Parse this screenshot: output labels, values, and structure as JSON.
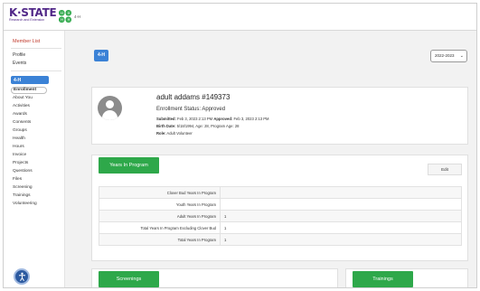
{
  "header": {
    "logo_text": "K·STATE",
    "logo_subtext": "Research and Extension",
    "program_label": "4-H"
  },
  "sidebar": {
    "title": "Member List",
    "links": [
      "Profile",
      "Events"
    ],
    "active_section": "4-H",
    "items": [
      "Enrollment",
      "About You",
      "Activities",
      "Awards",
      "Consents",
      "Groups",
      "Health",
      "Hours",
      "Invoice",
      "Projects",
      "Questions",
      "Files",
      "Screening",
      "Trainings",
      "Volunteering"
    ],
    "current_item": "Enrollment"
  },
  "main": {
    "section_button": "4-H",
    "year_select": "2022-2023",
    "profile": {
      "name": "adult addams #149373",
      "enrollment_status": "Enrollment Status: Approved",
      "submitted_label": "Submitted:",
      "submitted_value": "Feb 3, 2023 2:13 PM",
      "approved_label": "Approved:",
      "approved_value": "Feb 3, 2023 2:13 PM",
      "birth_label": "Birth Date:",
      "birth_value": "5/18/1994, Age: 28, Program Age: 28",
      "role_label": "Role:",
      "role_value": "Adult Volunteer"
    },
    "years": {
      "tab_label": "Years In Program",
      "edit_label": "Edit",
      "rows": [
        {
          "label": "Clover Bud Years In Program",
          "value": ""
        },
        {
          "label": "Youth Years In Program",
          "value": ""
        },
        {
          "label": "Adult Years In Program",
          "value": "1"
        },
        {
          "label": "Total Years In Program Excluding Clover Bud",
          "value": "1"
        },
        {
          "label": "Total Years In Program",
          "value": "1"
        }
      ]
    },
    "screenings_label": "Screenings",
    "trainings_label": "Trainings"
  },
  "colors": {
    "brand_purple": "#512888",
    "primary_blue": "#3b82d6",
    "section_green": "#2ea84a",
    "member_list_red": "#c0392b"
  }
}
